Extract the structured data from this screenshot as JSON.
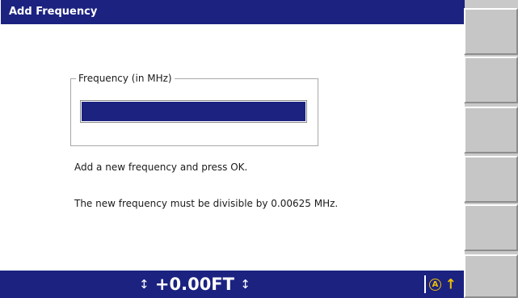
{
  "dialog": {
    "title": "Add Frequency",
    "group_label": "Frequency (in MHz)",
    "frequency_value": "",
    "message_1": "Add a new frequency and press OK.",
    "message_2": "The new frequency must be divisible by 0.00625 MHz."
  },
  "status_bar": {
    "altitude_arrow_left": "↕",
    "altitude": "+0.00FT",
    "altitude_arrow_right": "↕",
    "mode_icon": "circled-a-icon",
    "mode_letter": "A",
    "up_icon": "up-arrow-icon",
    "up_glyph": "↑",
    "accent_color": "#f0c000"
  },
  "colors": {
    "title_bar": "#1b2280",
    "status_bar": "#1b2280",
    "softkey": "#c6c6c6"
  },
  "softkeys": [
    {
      "label": ""
    },
    {
      "label": ""
    },
    {
      "label": ""
    },
    {
      "label": ""
    },
    {
      "label": ""
    },
    {
      "label": ""
    }
  ]
}
